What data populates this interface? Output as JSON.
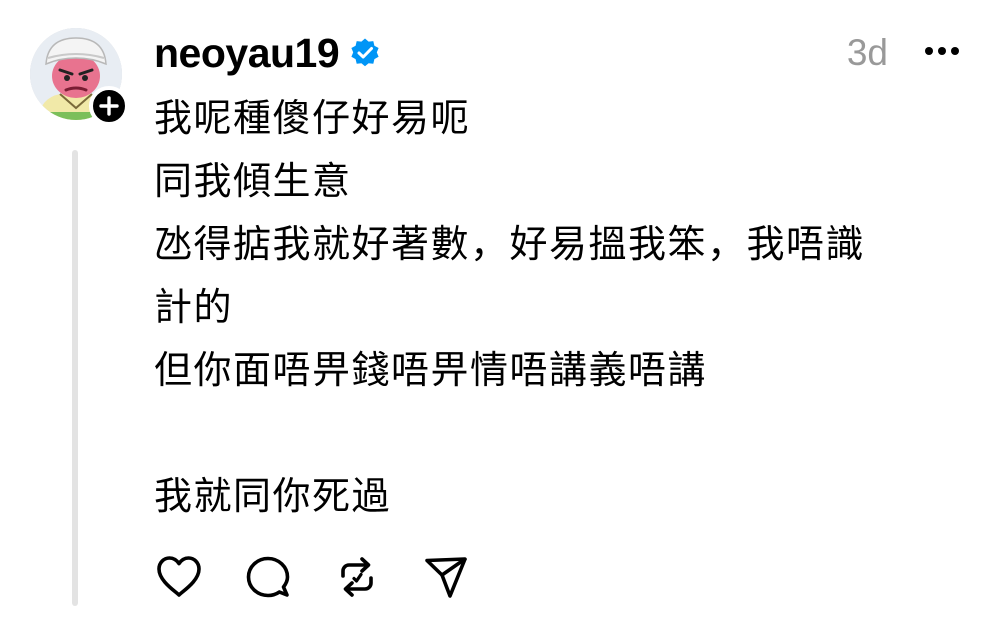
{
  "post": {
    "username": "neoyau19",
    "verified": true,
    "time": "3d",
    "lines": [
      "我呢種傻仔好易呃",
      "同我傾生意",
      "氹得掂我就好著數，好易搵我笨，我唔識",
      "計的",
      "但你面唔畀錢唔畀情唔講義唔講",
      "",
      "我就同你死過"
    ]
  },
  "icons": {
    "avatar": "cartoon-avatar",
    "follow": "plus-icon",
    "verified": "verified-badge-icon",
    "more": "more-horizontal-icon",
    "like": "heart-icon",
    "reply": "comment-bubble-icon",
    "repost": "repost-icon",
    "share": "send-icon"
  },
  "colors": {
    "text": "#000000",
    "muted": "#999999",
    "verified_blue": "#0095f6",
    "thread_line": "#e3e3e3"
  }
}
